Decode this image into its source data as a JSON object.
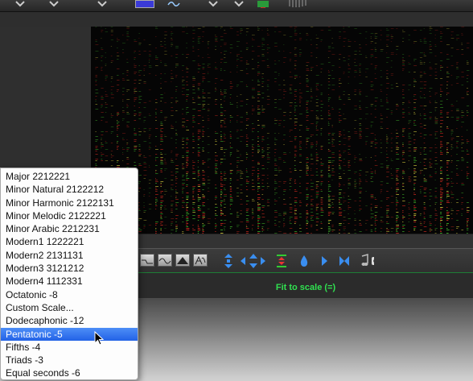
{
  "app": {
    "status_text": "Fit to scale (=)",
    "colors": {
      "spectrogram_bg": "#050505",
      "status_green": "#30e050",
      "menu_highlight": "#2a6ef0",
      "line_green": "#1d7d35"
    }
  },
  "toolbar_icons": [
    "chevron-down-icon",
    "chevron-down-icon",
    "chevron-down-icon",
    "blue-square-icon",
    "wave-icon",
    "chevron-down-icon",
    "chevron-down-icon",
    "green-meter-icon",
    "spiral-icon"
  ],
  "tool_buttons": [
    "flat-line-tool",
    "sine-wave-tool",
    "triangle-wave-tool",
    "sawtooth-tool",
    "a-wave-tool"
  ],
  "tool_icons": [
    "expand-vertical-icon",
    "arrow-left-icon",
    "arrow-up-down-icon",
    "arrow-right-icon",
    "fit-to-scale-icon",
    "droplet-icon",
    "play-icon",
    "collapse-icon",
    "music-note-icon"
  ],
  "scale_menu": {
    "items": [
      {
        "label": "Major 2212221"
      },
      {
        "label": "Minor Natural 2122212"
      },
      {
        "label": "Minor Harmonic 2122131"
      },
      {
        "label": "Minor Melodic 2122221"
      },
      {
        "label": "Minor Arabic 2212231"
      },
      {
        "label": "Modern1 1222221"
      },
      {
        "label": "Modern2 2131131"
      },
      {
        "label": "Modern3 3121212"
      },
      {
        "label": "Modern4 1112331"
      },
      {
        "label": "Octatonic -8"
      },
      {
        "label": "Custom Scale..."
      },
      {
        "label": "Dodecaphonic -12"
      },
      {
        "label": "Pentatonic -5"
      },
      {
        "label": "Fifths -4"
      },
      {
        "label": "Triads -3"
      },
      {
        "label": "Equal seconds -6"
      }
    ],
    "selected": "Pentatonic -5"
  }
}
